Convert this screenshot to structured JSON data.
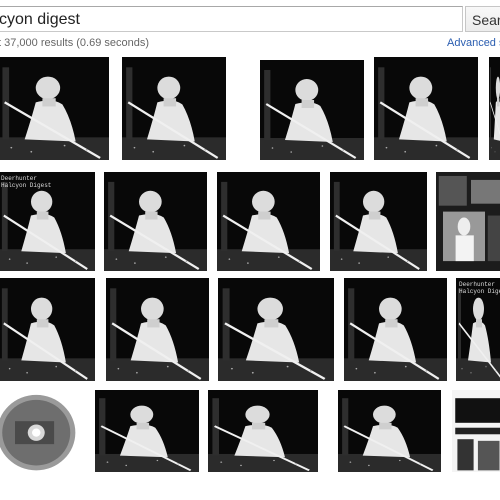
{
  "search": {
    "query": "cyon digest",
    "button_label": "Search"
  },
  "stats": {
    "text": "t 37,000 results (0.69 seconds)",
    "advanced_label": "Advanced sea"
  },
  "thumb_caption": "Deerhunter\nHalcyon Digest",
  "colors": {
    "link": "#2a5db0",
    "thumb_background": "#0b0b0b",
    "figure": "#e9e9e9"
  },
  "icons": {
    "album_cover": "halcyon-digest-cover-icon",
    "cd_disc": "cd-disc-icon",
    "collage": "collage-photo-icon"
  }
}
